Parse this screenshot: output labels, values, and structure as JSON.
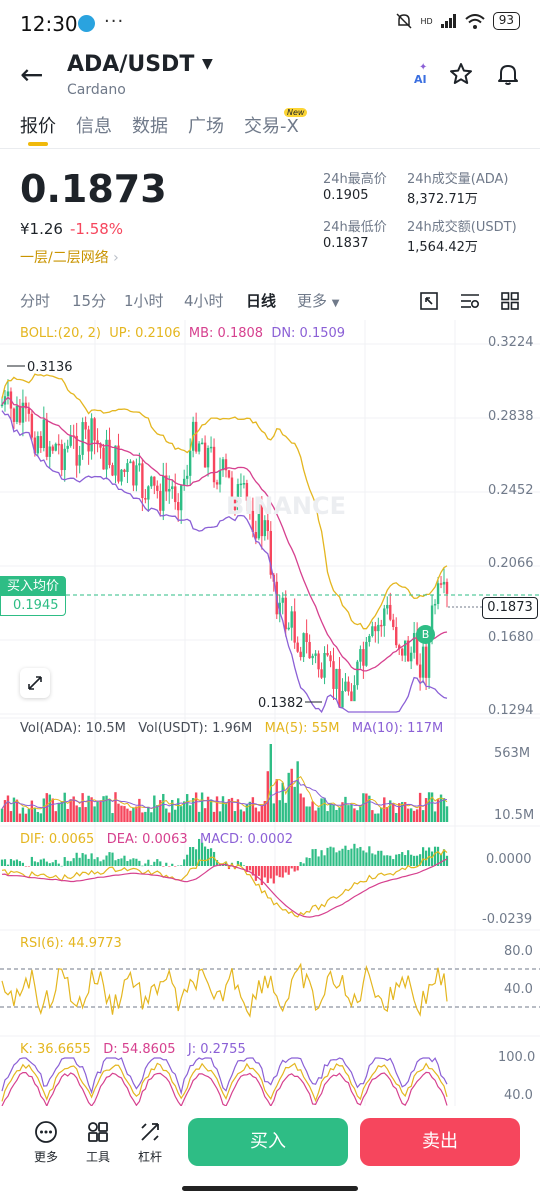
{
  "status_bar": {
    "time": "12:30",
    "menu_dots": "···",
    "network": "HD",
    "battery": "93"
  },
  "header": {
    "pair": "ADA/USDT",
    "dropdown": "▼",
    "name": "Cardano",
    "back_icon": "←",
    "ai_label": "AI"
  },
  "tabs": [
    {
      "label": "报价",
      "active": true
    },
    {
      "label": "信息"
    },
    {
      "label": "数据"
    },
    {
      "label": "广场"
    },
    {
      "label": "交易-X",
      "badge": "New"
    }
  ],
  "quote": {
    "price": "0.1873",
    "fiat": "¥1.26",
    "change": "-1.58%",
    "network_link": "一层/二层网络",
    "high_label": "24h最高价",
    "high": "0.1905",
    "low_label": "24h最低价",
    "low": "0.1837",
    "vol_label": "24h成交量(ADA)",
    "vol": "8,372.71万",
    "amt_label": "24h成交额(USDT)",
    "amt": "1,564.42万"
  },
  "intervals": [
    "分时",
    "15分",
    "1小时",
    "4小时",
    "日线",
    "更多"
  ],
  "active_interval": "日线",
  "chart": {
    "boll": {
      "label": "BOLL:(20, 2)",
      "up": "UP: 0.2106",
      "mb": "MB: 0.1808",
      "dn": "DN: 0.1509"
    },
    "price_axis": [
      "0.3224",
      "0.2838",
      "0.2452",
      "0.2066",
      "0.1680",
      "0.1294"
    ],
    "high_marker": "0.3136",
    "low_marker": "0.1382",
    "current_price_tag": "0.1873",
    "buy_avg_label": "买入均价",
    "buy_avg_value": "0.1945",
    "buy_marker": "B",
    "watermark": "BINANCE",
    "volume": {
      "vol_ada": "Vol(ADA): 10.5M",
      "vol_usdt": "Vol(USDT): 1.96M",
      "ma5": "MA(5): 55M",
      "ma10": "MA(10): 117M",
      "axis_top": "563M",
      "axis_bottom": "10.5M"
    },
    "macd": {
      "dif": "DIF: 0.0065",
      "dea": "DEA: 0.0063",
      "macd": "MACD: 0.0002",
      "axis_top": "0.0000",
      "axis_bottom": "-0.0239"
    },
    "rsi": {
      "label": "RSI(6): 44.9773",
      "axis_top": "80.0",
      "axis_mid": "40.0"
    },
    "kdj": {
      "k": "K: 36.6655",
      "d": "D: 54.8605",
      "j": "J: 0.2755",
      "axis_top": "100.0",
      "axis_mid": "40.0"
    }
  },
  "colors": {
    "up": "#2ebd85",
    "down": "#f6465d",
    "accent": "#f0b90b",
    "boll_up": "#e4b620",
    "boll_mb": "#d6418f",
    "boll_dn": "#8b60d6"
  },
  "bottom_bar": {
    "more": "更多",
    "tools": "工具",
    "leverage": "杠杆",
    "buy": "买入",
    "sell": "卖出"
  }
}
